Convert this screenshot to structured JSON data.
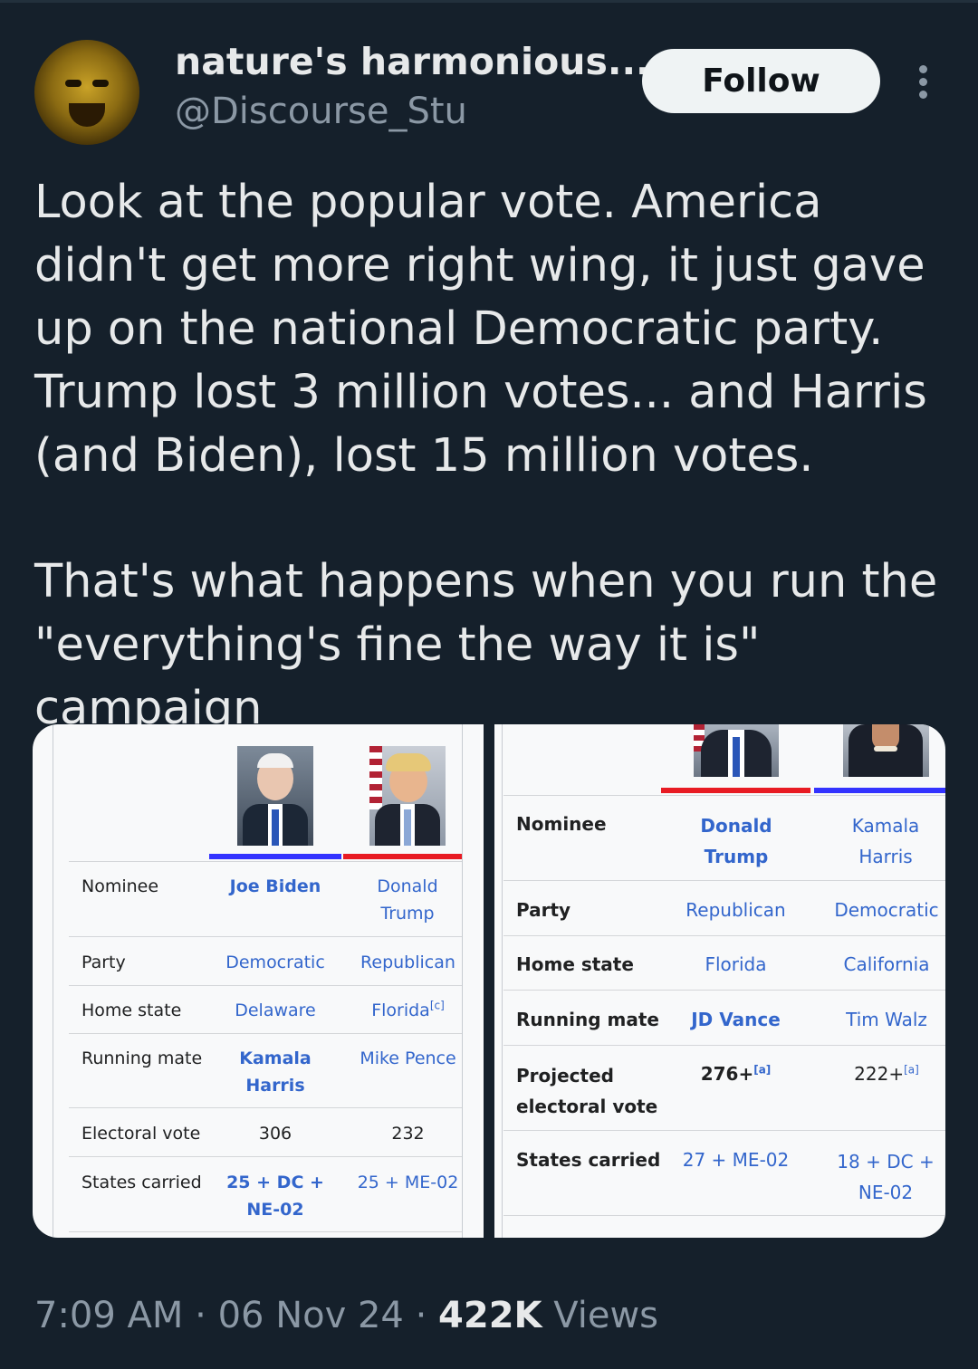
{
  "author": {
    "display_name": "nature's harmonious...",
    "handle": "@Discourse_Stu",
    "follow_label": "Follow"
  },
  "tweet": {
    "paragraph1": "Look at the popular vote. America didn't get more right wing, it just gave up on the national Democratic party. Trump lost 3 million votes... and Harris (and Biden), lost 15 million votes.",
    "paragraph2": "That's what happens when you run the \"everything's fine the way it is\" campaign"
  },
  "table_2020": {
    "labels": {
      "nominee": "Nominee",
      "party": "Party",
      "home_state": "Home state",
      "running_mate": "Running mate",
      "electoral_vote": "Electoral vote",
      "states_carried": "States carried"
    },
    "candidates": [
      {
        "nominee": "Joe Biden",
        "party": "Democratic",
        "home_state": "Delaware",
        "running_mate": "Kamala Harris",
        "electoral_vote": "306",
        "states_carried": "25 + DC + NE-02",
        "color": "#3333ff"
      },
      {
        "nominee": "Donald Trump",
        "party": "Republican",
        "home_state": "Florida",
        "home_state_note": "[c]",
        "running_mate": "Mike Pence",
        "electoral_vote": "232",
        "states_carried": "25 + ME-02",
        "color": "#e81b23"
      }
    ]
  },
  "table_2024": {
    "labels": {
      "nominee": "Nominee",
      "party": "Party",
      "home_state": "Home state",
      "running_mate": "Running mate",
      "projected_ev": "Projected electoral vote",
      "states_carried": "States carried"
    },
    "candidates": [
      {
        "nominee": "Donald Trump",
        "party": "Republican",
        "home_state": "Florida",
        "running_mate": "JD Vance",
        "projected_ev": "276+",
        "projected_ev_note": "[a]",
        "states_carried": "27 + ME-02",
        "color": "#e81b23"
      },
      {
        "nominee": "Kamala Harris",
        "party": "Democratic",
        "home_state": "California",
        "running_mate": "Tim Walz",
        "projected_ev": "222+",
        "projected_ev_note": "[a]",
        "states_carried": "18 + DC + NE-02",
        "color": "#3333ff"
      }
    ]
  },
  "meta": {
    "time": "7:09 AM",
    "sep1": "·",
    "date": "06 Nov 24",
    "sep2": "·",
    "views_count": "422K",
    "views_label": "Views"
  }
}
